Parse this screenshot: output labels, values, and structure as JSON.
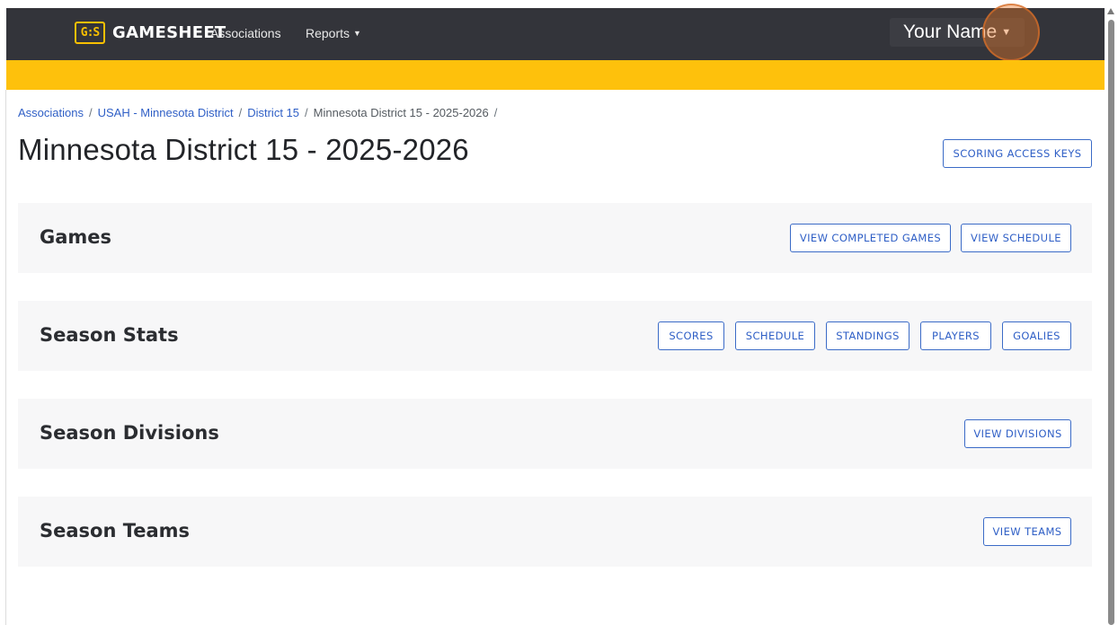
{
  "navbar": {
    "logo_mark": "G:S",
    "brand": "GAMESHEET",
    "links": {
      "associations": "Associations",
      "reports": "Reports"
    },
    "user": "Your Name"
  },
  "breadcrumb": {
    "items": [
      "Associations",
      "USAH - Minnesota District",
      "District 15"
    ],
    "current": "Minnesota District 15 - 2025-2026",
    "separator": "/"
  },
  "page": {
    "title": "Minnesota District 15 - 2025-2026",
    "scoring_button": "SCORING ACCESS KEYS"
  },
  "panels": {
    "games": {
      "title": "Games",
      "buttons": [
        "VIEW COMPLETED GAMES",
        "VIEW SCHEDULE"
      ]
    },
    "stats": {
      "title": "Season Stats",
      "buttons": [
        "SCORES",
        "SCHEDULE",
        "STANDINGS",
        "PLAYERS",
        "GOALIES"
      ]
    },
    "divisions": {
      "title": "Season Divisions",
      "buttons": [
        "VIEW DIVISIONS"
      ]
    },
    "teams": {
      "title": "Season Teams",
      "buttons": [
        "VIEW TEAMS"
      ]
    }
  },
  "colors": {
    "navbar": "#33343a",
    "accent": "#fec10c",
    "link": "#2f5fc6",
    "panel_bg": "#f7f7f8",
    "highlight": "#e87828"
  },
  "icons": [
    "gamesheet-logo-icon",
    "caret-down-icon",
    "scroll-up-arrow-icon"
  ]
}
